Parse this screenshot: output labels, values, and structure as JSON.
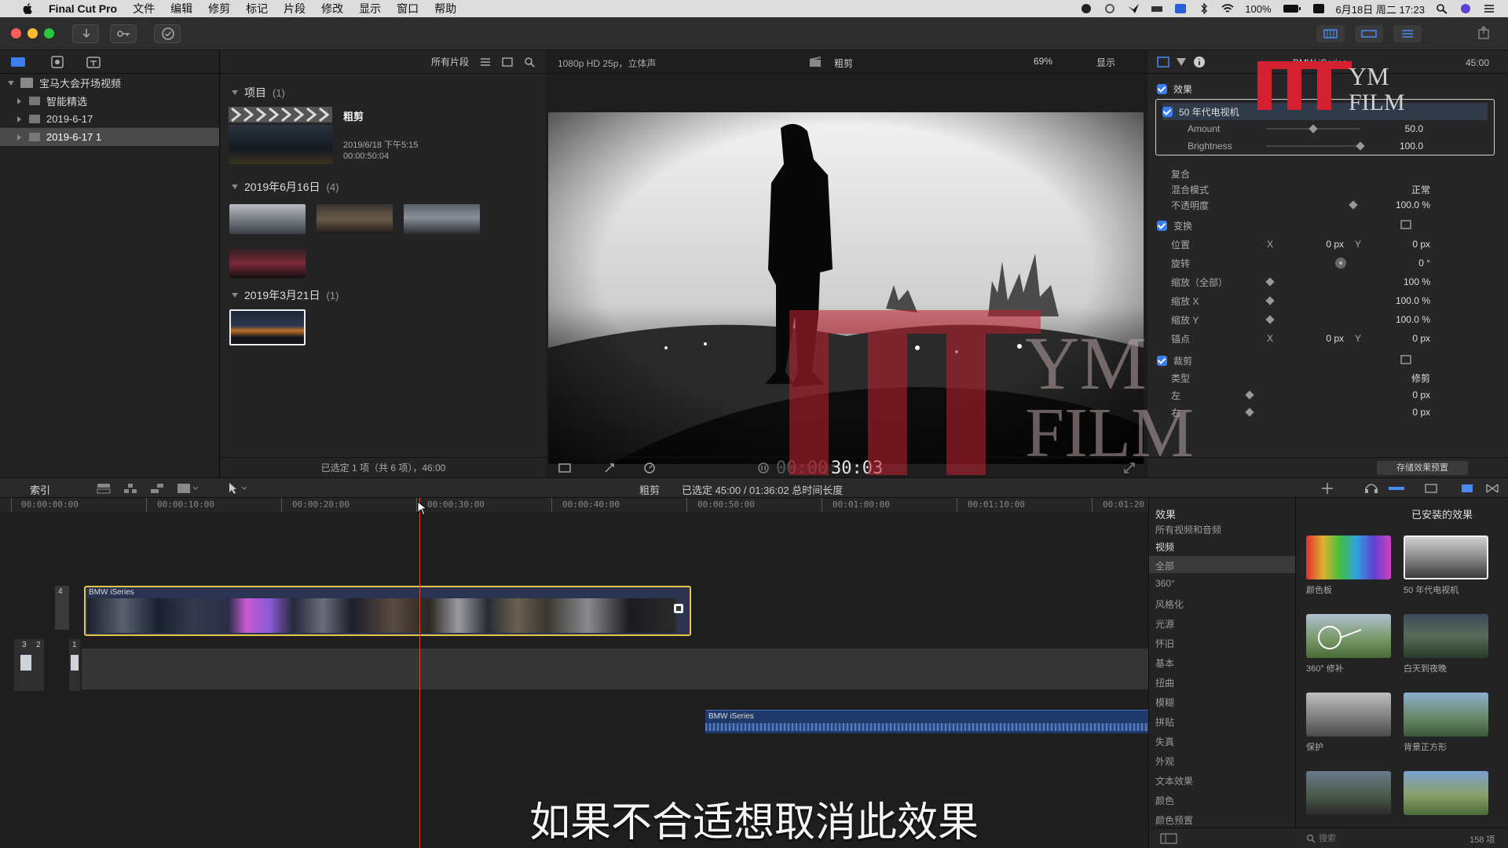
{
  "menubar": {
    "app": "Final Cut Pro",
    "items": [
      "文件",
      "编辑",
      "修剪",
      "标记",
      "片段",
      "修改",
      "显示",
      "窗口",
      "帮助"
    ],
    "battery": "100%",
    "datetime": "6月18日 周二 17:23"
  },
  "library": {
    "root": "宝马大会开场视频",
    "items": [
      {
        "label": "智能精选",
        "selected": false
      },
      {
        "label": "2019-6-17",
        "selected": false
      },
      {
        "label": "2019-6-17 1",
        "selected": true
      }
    ]
  },
  "browser": {
    "filter": "所有片段",
    "groups": [
      {
        "title": "项目",
        "count": "(1)"
      },
      {
        "title": "2019年6月16日",
        "count": "(4)"
      },
      {
        "title": "2019年3月21日",
        "count": "(1)"
      }
    ],
    "project": {
      "name": "粗剪",
      "date": "2019/6/18 下午5:15",
      "duration": "00:00:50:04"
    },
    "status": "已选定 1 项（共 6 项），46:00"
  },
  "viewer": {
    "format": "1080p HD 25p，立体声",
    "project": "粗剪",
    "zoom": "69%",
    "display": "显示",
    "timecode_dim": "00:00:",
    "timecode": "30:03"
  },
  "inspector": {
    "clip_name": "BMW iSeries",
    "duration": "45:00",
    "effects_label": "效果",
    "effect_name": "50 年代电视机",
    "params": [
      {
        "label": "Amount",
        "value": "50.0"
      },
      {
        "label": "Brightness",
        "value": "100.0"
      }
    ],
    "composite": {
      "title": "复合",
      "blend_label": "混合模式",
      "blend_value": "正常",
      "opacity_label": "不透明度",
      "opacity_value": "100.0 %"
    },
    "transform": {
      "title": "变换",
      "rows": [
        {
          "label": "位置",
          "x": "X",
          "xv": "0 px",
          "y": "Y",
          "yv": "0 px"
        },
        {
          "label": "旋转",
          "value": "0 °"
        },
        {
          "label": "缩放（全部）",
          "value": "100 %"
        },
        {
          "label": "缩放 X",
          "value": "100.0 %"
        },
        {
          "label": "缩放 Y",
          "value": "100.0 %"
        },
        {
          "label": "锚点",
          "x": "X",
          "xv": "0 px",
          "y": "Y",
          "yv": "0 px"
        }
      ]
    },
    "crop": {
      "title": "裁剪",
      "type_label": "类型",
      "type_value": "修剪",
      "rows": [
        {
          "label": "左",
          "value": "0 px"
        },
        {
          "label": "右",
          "value": "0 px"
        }
      ]
    },
    "save_preset": "存储效果预置"
  },
  "watermark": {
    "line1": "YM",
    "line2": "FILM"
  },
  "timeline": {
    "index_label": "索引",
    "project": "粗剪",
    "selection_info": "已选定 45:00 / 01:36:02 总时间长度",
    "ruler": [
      "00:00:00:00",
      "00:00:10:00",
      "00:00:20:00",
      "00:00:30:00",
      "00:00:40:00",
      "00:00:50:00",
      "00:01:00:00",
      "00:01:10:00",
      "00:01:20"
    ],
    "clip_name": "BMW iSeries",
    "audio_name": "BMW iSeries",
    "lane_labels": [
      "4",
      "3",
      "2",
      "1"
    ]
  },
  "effects": {
    "title": "效果",
    "installed": "已安装的效果",
    "categories": [
      "所有视频和音频",
      "视频",
      "全部",
      "360°",
      "风格化",
      "光源",
      "怀旧",
      "基本",
      "扭曲",
      "模糊",
      "拼贴",
      "失真",
      "外观",
      "文本效果",
      "颜色",
      "颜色预置"
    ],
    "selected_category": "全部",
    "items": [
      {
        "label": "颜色板"
      },
      {
        "label": "50 年代电视机"
      },
      {
        "label": "360° 修补"
      },
      {
        "label": "白天到夜晚"
      },
      {
        "label": "保护"
      },
      {
        "label": "背景正方形"
      }
    ],
    "search_placeholder": "搜索",
    "count": "158 项"
  },
  "subtitle": "如果不合适想取消此效果"
}
